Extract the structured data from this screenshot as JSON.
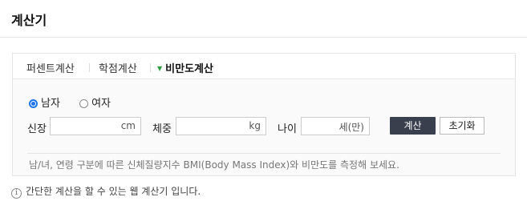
{
  "header": {
    "title": "계산기"
  },
  "tabs": [
    {
      "label": "퍼센트계산"
    },
    {
      "label": "학점계산"
    },
    {
      "label": "비만도계산"
    }
  ],
  "gender": {
    "male": "남자",
    "female": "여자",
    "selected": "남자"
  },
  "fields": {
    "height_label": "신장",
    "height_unit": "cm",
    "height_value": "",
    "weight_label": "체중",
    "weight_unit": "kg",
    "weight_value": "",
    "age_label": "나이",
    "age_unit": "세(만)",
    "age_value": ""
  },
  "buttons": {
    "calc": "계산",
    "reset": "초기화"
  },
  "description": "남/녀, 연령 구분에 따른 신체질량지수 BMI(Body Mass Index)와 비만도를 측정해 보세요.",
  "footer": {
    "text": "간단한 계산을 할 수 있는 웹 계산기 입니다.",
    "icon": "info-icon"
  }
}
